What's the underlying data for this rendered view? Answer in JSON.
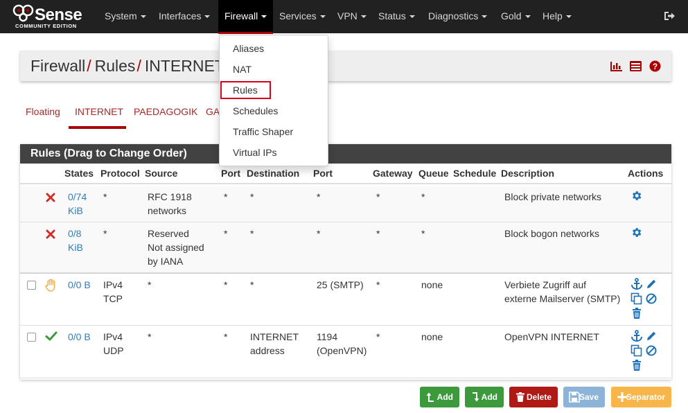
{
  "brand": {
    "name": "Sense",
    "edition": "COMMUNITY EDITION"
  },
  "navbar": {
    "items": [
      {
        "label": "System"
      },
      {
        "label": "Interfaces"
      },
      {
        "label": "Firewall"
      },
      {
        "label": "Services"
      },
      {
        "label": "VPN"
      },
      {
        "label": "Status"
      },
      {
        "label": "Diagnostics"
      },
      {
        "label": "Gold"
      },
      {
        "label": "Help"
      }
    ],
    "active": "Firewall",
    "logout_icon": "sign-out-icon"
  },
  "breadcrumb": {
    "parts": [
      "Firewall",
      "Rules",
      "INTERNET"
    ],
    "separator": "/"
  },
  "header_icons": [
    "bar-chart-icon",
    "list-table-icon",
    "help-circle-icon"
  ],
  "tabs": [
    "Floating",
    "INTERNET",
    "PAEDAGOGIK",
    "GA"
  ],
  "active_tab": "INTERNET",
  "firewall_menu": {
    "items": [
      "Aliases",
      "NAT",
      "Rules",
      "Schedules",
      "Traffic Shaper",
      "Virtual IPs"
    ],
    "highlighted": "Rules"
  },
  "rules_panel": {
    "title": "Rules (Drag to Change Order)",
    "columns": [
      "States",
      "Protocol",
      "Source",
      "Port",
      "Destination",
      "Port",
      "Gateway",
      "Queue",
      "Schedule",
      "Description",
      "Actions"
    ],
    "rows": [
      {
        "status_icon": "block-x-icon",
        "states": [
          "0/74",
          "KiB"
        ],
        "protocol": [
          "*"
        ],
        "source": [
          "RFC 1918",
          "networks"
        ],
        "src_port": "*",
        "destination": [
          "*"
        ],
        "dst_port": [
          "*"
        ],
        "gateway": "*",
        "queue": "*",
        "schedule": "",
        "description": [
          "Block private networks"
        ]
      },
      {
        "status_icon": "block-x-icon",
        "states": [
          "0/8",
          "KiB"
        ],
        "protocol": [
          "*"
        ],
        "source": [
          "Reserved",
          "Not assigned",
          "by IANA"
        ],
        "src_port": "*",
        "destination": [
          "*"
        ],
        "dst_port": [
          "*"
        ],
        "gateway": "*",
        "queue": "*",
        "schedule": "",
        "description": [
          "Block bogon networks"
        ]
      },
      {
        "status_icon": "reject-hand-icon",
        "states": [
          "0/0 B"
        ],
        "protocol": [
          "IPv4",
          "TCP"
        ],
        "source": [
          "*"
        ],
        "src_port": "*",
        "destination": [
          "*"
        ],
        "dst_port": [
          "25 (SMTP)"
        ],
        "gateway": "*",
        "queue": "none",
        "schedule": "",
        "description": [
          "Verbiete Zugriff auf",
          "externe Mailserver (SMTP)"
        ]
      },
      {
        "status_icon": "pass-check-icon",
        "states": [
          "0/0 B"
        ],
        "protocol": [
          "IPv4",
          "UDP"
        ],
        "source": [
          "*"
        ],
        "src_port": "*",
        "destination": [
          "INTERNET",
          "address"
        ],
        "dst_port": [
          "1194",
          "(OpenVPN)"
        ],
        "gateway": "*",
        "queue": "none",
        "schedule": "",
        "description": [
          "OpenVPN INTERNET"
        ]
      }
    ]
  },
  "buttons": [
    {
      "label": "Add",
      "icon": "arrow-up-add-icon"
    },
    {
      "label": "Add",
      "icon": "arrow-down-add-icon"
    },
    {
      "label": "Delete",
      "icon": "trash-icon"
    },
    {
      "label": "Save",
      "icon": "save-icon"
    },
    {
      "label": "Separator",
      "icon": "plus-icon"
    }
  ],
  "colors": {
    "navbar": "#212121",
    "accent": "#ac0000",
    "link": "#317cb4",
    "action_icon": "#1e73b8",
    "green": "#3c9a3c",
    "red": "#b01a14",
    "orange": "#f8b64a"
  }
}
